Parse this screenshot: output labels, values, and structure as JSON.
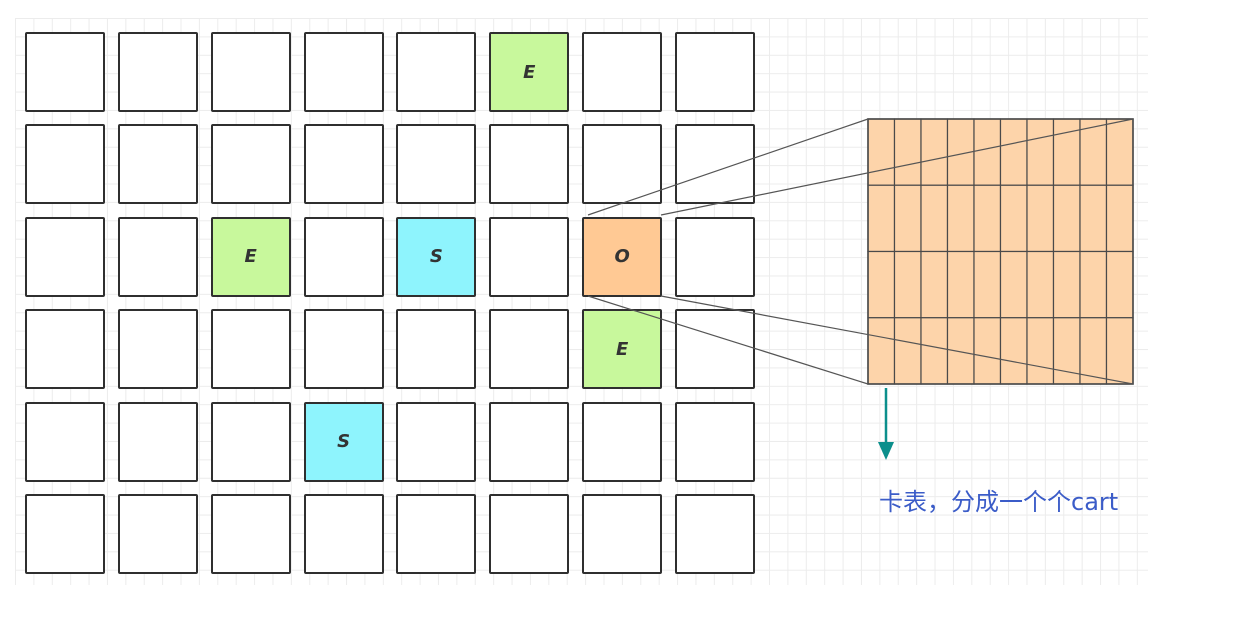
{
  "region_grid": {
    "rows": [
      [
        "",
        "",
        "",
        "",
        "",
        "E",
        "",
        ""
      ],
      [
        "",
        "",
        "",
        "",
        "",
        "",
        "",
        ""
      ],
      [
        "",
        "",
        "E",
        "",
        "S",
        "",
        "O",
        ""
      ],
      [
        "",
        "",
        "",
        "",
        "",
        "",
        "E",
        ""
      ],
      [
        "",
        "",
        "",
        "S",
        "",
        "",
        "",
        ""
      ],
      [
        "",
        "",
        "",
        "",
        "",
        "",
        "",
        ""
      ]
    ],
    "colors": {
      "E": "#c8f89c",
      "S": "#8ef4fd",
      "O": "#ffc994",
      "empty": "#ffffff"
    }
  },
  "card_table": {
    "fill": "#fdd4aa",
    "line_color": "#4a4a4a"
  },
  "connector_color": "#555555",
  "arrow_color": "#0b8f8c",
  "caption": {
    "text": "卡表，分成一个个cart",
    "color": "#3b5cc8"
  }
}
